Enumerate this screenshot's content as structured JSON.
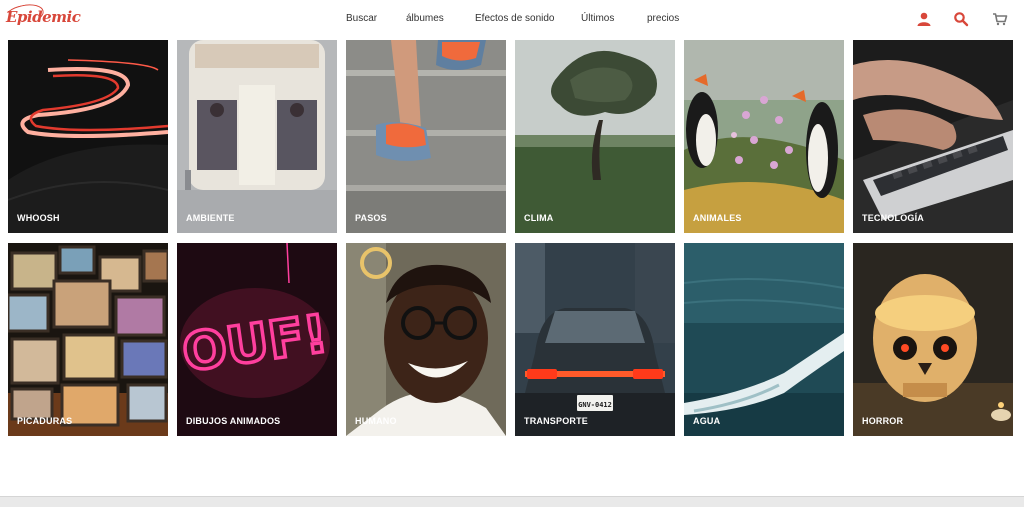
{
  "header": {
    "logo_text": "Epidemic",
    "nav": [
      "Buscar",
      "álbumes",
      "Efectos de sonido",
      "Últimos",
      "precios"
    ],
    "icons": [
      "user-icon",
      "search-icon",
      "cart-icon"
    ],
    "accent_color": "#d8473a"
  },
  "categories": [
    "WHOOSH",
    "AMBIENTE",
    "PASOS",
    "CLIMA",
    "ANIMALES",
    "TECNOLOGÍA",
    "PICADURAS",
    "DIBUJOS ANIMADOS",
    "HUMANO",
    "TRANSPORTE",
    "AGUA",
    "HORROR"
  ],
  "neon_sign_text": "OUF!",
  "license_plate_text": "GNV-0412"
}
